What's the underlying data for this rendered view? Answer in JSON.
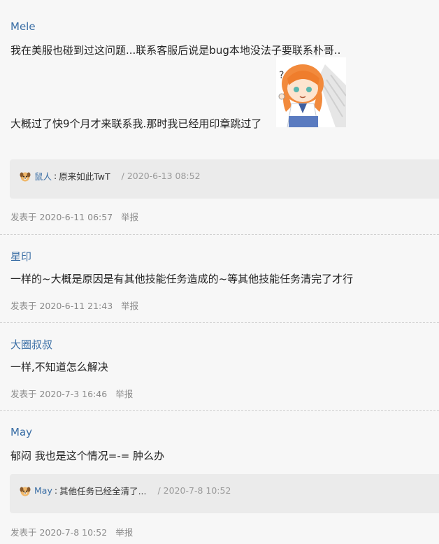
{
  "posts": [
    {
      "author": "Mele",
      "lines": [
        "我在美服也碰到过这问题...联系客服后说是bug本地没法子要联系朴哥..",
        "大概过了快9个月才来联系我.那时我已经用印章跳过了"
      ],
      "reply": {
        "user": "鼠人",
        "text": "原来如此TwT",
        "time": "/ 2020-6-13 08:52"
      },
      "meta": {
        "time": "发表于 2020-6-11 06:57",
        "report": "举报"
      }
    },
    {
      "author": "星印",
      "lines": [
        "一样的~大概是原因是有其他技能任务造成的~等其他技能任务清完了才行"
      ],
      "meta": {
        "time": "发表于 2020-6-11 21:43",
        "report": "举报"
      }
    },
    {
      "author": "大圈叔叔",
      "lines": [
        "一样,不知道怎么解决"
      ],
      "meta": {
        "time": "发表于 2020-7-3 16:46",
        "report": "举报"
      }
    },
    {
      "author": "May",
      "lines": [
        "郁闷 我也是这个情况=-= 肿么办"
      ],
      "reply": {
        "user": "May",
        "text": "其他任务已经全清了...",
        "time": "/ 2020-7-8 10:52"
      },
      "meta": {
        "time": "发表于 2020-7-8 10:52",
        "report": "举报"
      }
    }
  ],
  "colors": {
    "author": "#3a6ea5",
    "meta": "#8a8a8a",
    "reply_bg": "#ebebeb",
    "background": "#f7f7f7"
  },
  "icons": {
    "reply_avatar": "dog-avatar-icon",
    "sticker": "anime-girl-sticker"
  }
}
